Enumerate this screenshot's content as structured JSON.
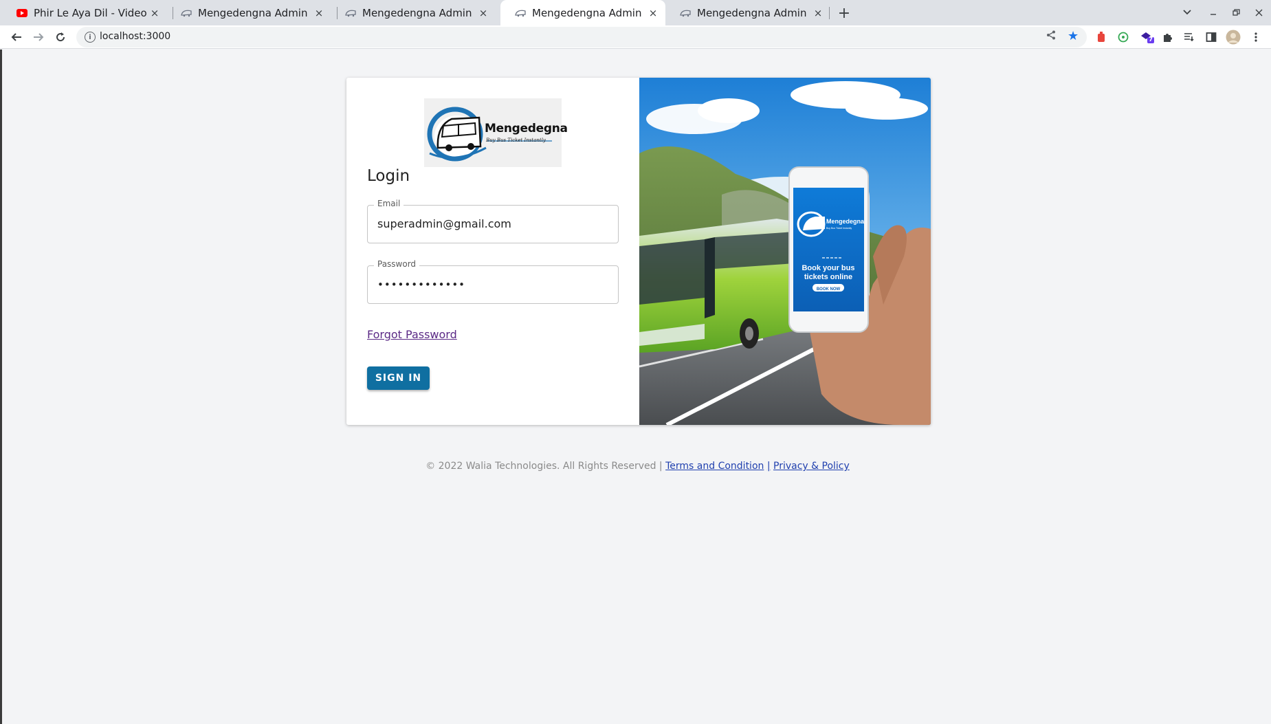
{
  "browser": {
    "tabs": [
      {
        "title": "Phir Le Aya Dil - Video Edit",
        "icon": "youtube-icon",
        "active": false
      },
      {
        "title": "Mengedengna Admin",
        "icon": "bus-favicon-icon",
        "active": false
      },
      {
        "title": "Mengedengna Admin",
        "icon": "bus-favicon-icon",
        "active": false
      },
      {
        "title": "Mengedengna Admin",
        "icon": "bus-favicon-icon",
        "active": true
      },
      {
        "title": "Mengedengna Admin",
        "icon": "bus-favicon-icon",
        "active": false
      }
    ],
    "tab_close_glyph": "×",
    "new_tab_glyph": "+",
    "url": "localhost:3000",
    "extension_badge": "7"
  },
  "login": {
    "logo_name": "Mengedegna",
    "logo_tagline": "Buy Bus Ticket Instantly",
    "title": "Login",
    "email_label": "Email",
    "email_value": "superadmin@gmail.com",
    "password_label": "Password",
    "password_value": "•••••••••••••",
    "forgot_password": "Forgot Password",
    "sign_in": "SIGN IN"
  },
  "hero": {
    "phone_brand": "Mengedegna",
    "phone_tagline": "Buy Bus Ticket Instantly",
    "phone_headline_1": "Book your bus",
    "phone_headline_2": "tickets online",
    "phone_cta": "BOOK NOW"
  },
  "footer": {
    "copyright": "© 2022 Walia Technologies. All Rights Reserved |",
    "terms": "Terms and Condition",
    "separator": "|",
    "privacy": "Privacy & Policy"
  },
  "colors": {
    "primary_button": "#0f6fa1",
    "link": "#5b2a86",
    "footer_link": "#1f3fae",
    "page_bg": "#f3f4f6"
  }
}
